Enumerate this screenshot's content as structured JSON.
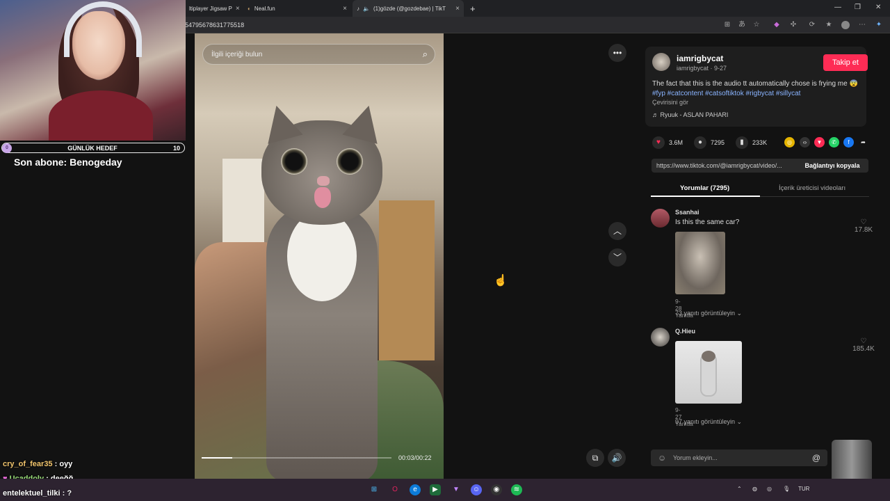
{
  "browser": {
    "tabs": [
      {
        "title": "ltiplayer Jigsaw P"
      },
      {
        "title": "Neal.fun"
      },
      {
        "title": "(1)gözde (@gozdebae) | TikT"
      }
    ],
    "new_tab": "+",
    "url": "54795678631775518"
  },
  "stream": {
    "goal_label": "GÜNLÜK HEDEF",
    "goal_count": "10",
    "goal_dot": "0",
    "last_sub": "Son abone: Benogeday",
    "chat": [
      {
        "user": "cry_of_fear35",
        "sep": " : ",
        "msg": "oyy"
      },
      {
        "user": "Ucaddoly",
        "sep": " : ",
        "msg": "deeğğ"
      },
      {
        "user": "entelektuel_tilki",
        "sep": " : ",
        "msg": "?"
      }
    ]
  },
  "video": {
    "search_placeholder": "İlgili içeriği bulun",
    "time": "00:03/00:22",
    "progress_fraction": 0.16
  },
  "post": {
    "username": "iamrigbycat",
    "handle": "iamrigbycat · 9-27",
    "follow_label": "Takip et",
    "description_text": "The fact that this is the audio tt automatically chose is frying me 😨 ",
    "hashtags": "#fyp #catcontent #catsoftiktok #rigbycat #sillycat",
    "translate": "Çevirisini gör",
    "music": "♬  Ryuuk - ASLAN PAHARI",
    "likes": "3.6M",
    "comments_count": "7295",
    "saves": "233K",
    "link": "https://www.tiktok.com/@iamrigbycat/video/...",
    "copy_label": "Bağlantıyı kopyala",
    "tab_comments": "Yorumlar (7295)",
    "tab_videos": "İçerik üreticisi videoları"
  },
  "comments": [
    {
      "name": "Ssanhai",
      "text": "Is this the same car?",
      "date": "9-28",
      "reply": "Yanıtla",
      "replies": "73 yanıtı görüntüleyin ⌄",
      "likes": "17.8K"
    },
    {
      "name": "Q.Hieu",
      "text": "",
      "date": "9-27",
      "reply": "Yanıtla",
      "replies": "97 yanıtı görüntüleyin ⌄",
      "likes": "185.4K"
    }
  ],
  "comment_input_placeholder": "Yorum ekleyin...",
  "taskbar": {
    "lang": "TUR"
  },
  "colors": {
    "accent": "#fe2c55",
    "hashtag": "#8ab4ff",
    "taskbar": "#2d2330"
  }
}
